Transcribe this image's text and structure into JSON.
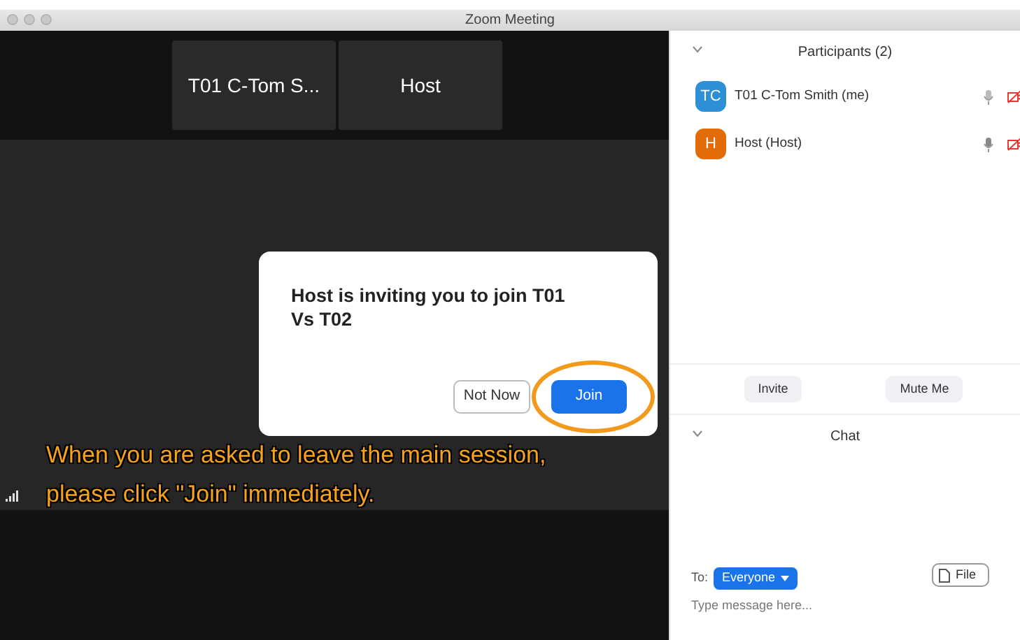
{
  "window": {
    "title": "Zoom Meeting"
  },
  "video_tiles": [
    {
      "name": "T01 C-Tom S..."
    },
    {
      "name": "Host"
    }
  ],
  "dialog": {
    "message": "Host is inviting you to join T01 Vs T02",
    "buttons": [
      {
        "label": "Not Now",
        "kind": "secondary"
      },
      {
        "label": "Join",
        "kind": "primary"
      }
    ]
  },
  "caption": [
    "When you are asked to leave the main session,",
    "please click \"Join\" immediately."
  ],
  "participants": {
    "title": "Participants (2)",
    "items": [
      {
        "initials": "TC",
        "name": "T01 C-Tom Smith (me)",
        "color": "#2d8fd5"
      },
      {
        "initials": "H",
        "name": "Host (Host)",
        "color": "#e26b0a"
      }
    ],
    "buttons": [
      "Invite",
      "Mute Me"
    ]
  },
  "chat": {
    "title": "Chat",
    "to_label": "To:",
    "recipient": "Everyone",
    "file_button": "File",
    "placeholder": "Type message here..."
  }
}
